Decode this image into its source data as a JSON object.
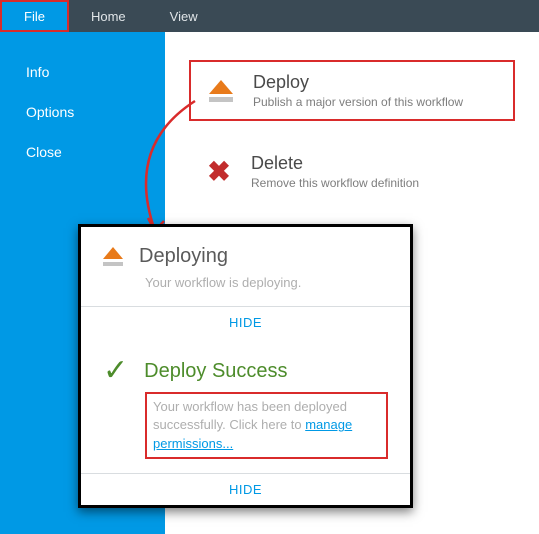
{
  "topbar": {
    "tabs": [
      {
        "label": "File",
        "active": true
      },
      {
        "label": "Home",
        "active": false
      },
      {
        "label": "View",
        "active": false
      }
    ]
  },
  "sidebar": {
    "items": [
      {
        "label": "Info"
      },
      {
        "label": "Options"
      },
      {
        "label": "Close"
      }
    ]
  },
  "actions": {
    "deploy": {
      "title": "Deploy",
      "subtitle": "Publish a major version of this workflow"
    },
    "delete": {
      "title": "Delete",
      "subtitle": "Remove this workflow definition"
    }
  },
  "popup": {
    "deploying": {
      "title": "Deploying",
      "desc": "Your workflow is deploying.",
      "hide": "HIDE"
    },
    "success": {
      "title": "Deploy Success",
      "desc_prefix": "Your workflow has been deployed successfully. Click here to ",
      "link": "manage permissions...",
      "hide": "HIDE"
    }
  },
  "colors": {
    "accent": "#0099e5",
    "orange": "#e87a1a",
    "red": "#c22c2c",
    "green": "#4d8c2b",
    "highlight": "#d92b2b"
  }
}
